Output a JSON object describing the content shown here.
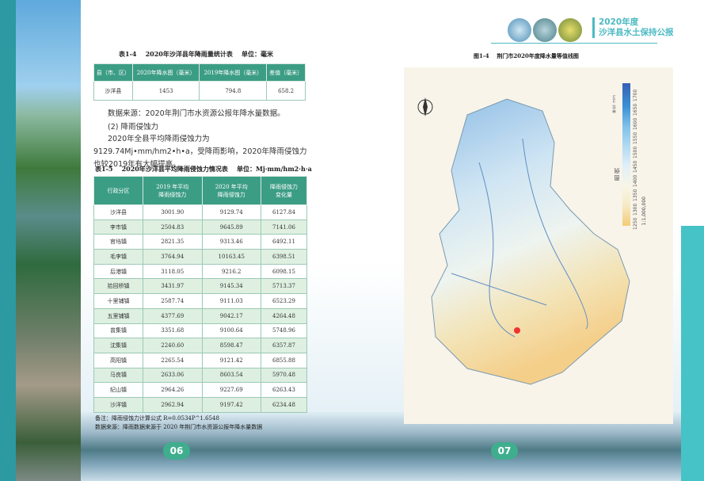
{
  "header": {
    "year": "2020年度",
    "title": "沙洋县水土保持公报"
  },
  "table14": {
    "caption": "表1-4    2020年沙洋县年降雨量统计表    单位：毫米",
    "headers": [
      "县（市、区）",
      "2020年降水图（毫米）",
      "2019年降水图（毫米）",
      "差值（毫米）"
    ],
    "row": [
      "沙洋县",
      "1453",
      "794.8",
      "658.2"
    ]
  },
  "text": {
    "source": "数据来源：2020年荆门市水资源公报年降水量数据。",
    "section": "(2) 降雨侵蚀力",
    "body": "2020年全县平均降雨侵蚀力为9129.74Mj•mm/hm2•h•a，受降雨影响，2020年降雨侵蚀力也较2019年有大幅提高。"
  },
  "table15": {
    "caption": "表1-5    2020年沙洋县平均降雨侵蚀力情况表    单位：Mj·mm/hm2·h·a",
    "headers": [
      "行政分区",
      "2019 年平均\n降雨侵蚀力",
      "2020 年平均\n降雨侵蚀力",
      "降雨侵蚀力\n变化量"
    ],
    "rows": [
      [
        "沙洋县",
        "3001.90",
        "9129.74",
        "6127.84"
      ],
      [
        "李市镇",
        "2504.83",
        "9645.89",
        "7141.06"
      ],
      [
        "官垱镇",
        "2821.35",
        "9313.46",
        "6492.11"
      ],
      [
        "毛李镇",
        "3764.94",
        "10163.45",
        "6398.51"
      ],
      [
        "后港镇",
        "3118.05",
        "9216.2",
        "6098.15"
      ],
      [
        "拾回桥镇",
        "3431.97",
        "9145.34",
        "5713.37"
      ],
      [
        "十里铺镇",
        "2587.74",
        "9111.03",
        "6523.29"
      ],
      [
        "五里铺镇",
        "4377.69",
        "9042.17",
        "4264.48"
      ],
      [
        "曾集镇",
        "3351.68",
        "9100.64",
        "5748.96"
      ],
      [
        "沈集镇",
        "2240.60",
        "8598.47",
        "6357.87"
      ],
      [
        "高阳镇",
        "2265.54",
        "9121.42",
        "6855.88"
      ],
      [
        "马良镇",
        "2633.06",
        "8603.54",
        "5970.48"
      ],
      [
        "纪山镇",
        "2964.26",
        "9227.69",
        "6263.43"
      ],
      [
        "沙洋镇",
        "2962.94",
        "9197.42",
        "6234.48"
      ]
    ],
    "note": "备注：降雨侵蚀力计算公式 R=0.0534P^1.6548",
    "source": "数据来源：降雨数据来源于 2020 年荆门市水资源公报年降水量数据"
  },
  "map": {
    "caption": "图1-4    荆门市2020年度降水量等值线图",
    "legend_title": "图  例",
    "unit": "单位: mm",
    "legend_values": [
      "1250",
      "1300",
      "1350",
      "1400",
      "1450",
      "1500",
      "1550",
      "1600",
      "1650",
      "1700"
    ],
    "scale": "1:1,000,000"
  },
  "pages": {
    "left": "06",
    "right": "07"
  }
}
